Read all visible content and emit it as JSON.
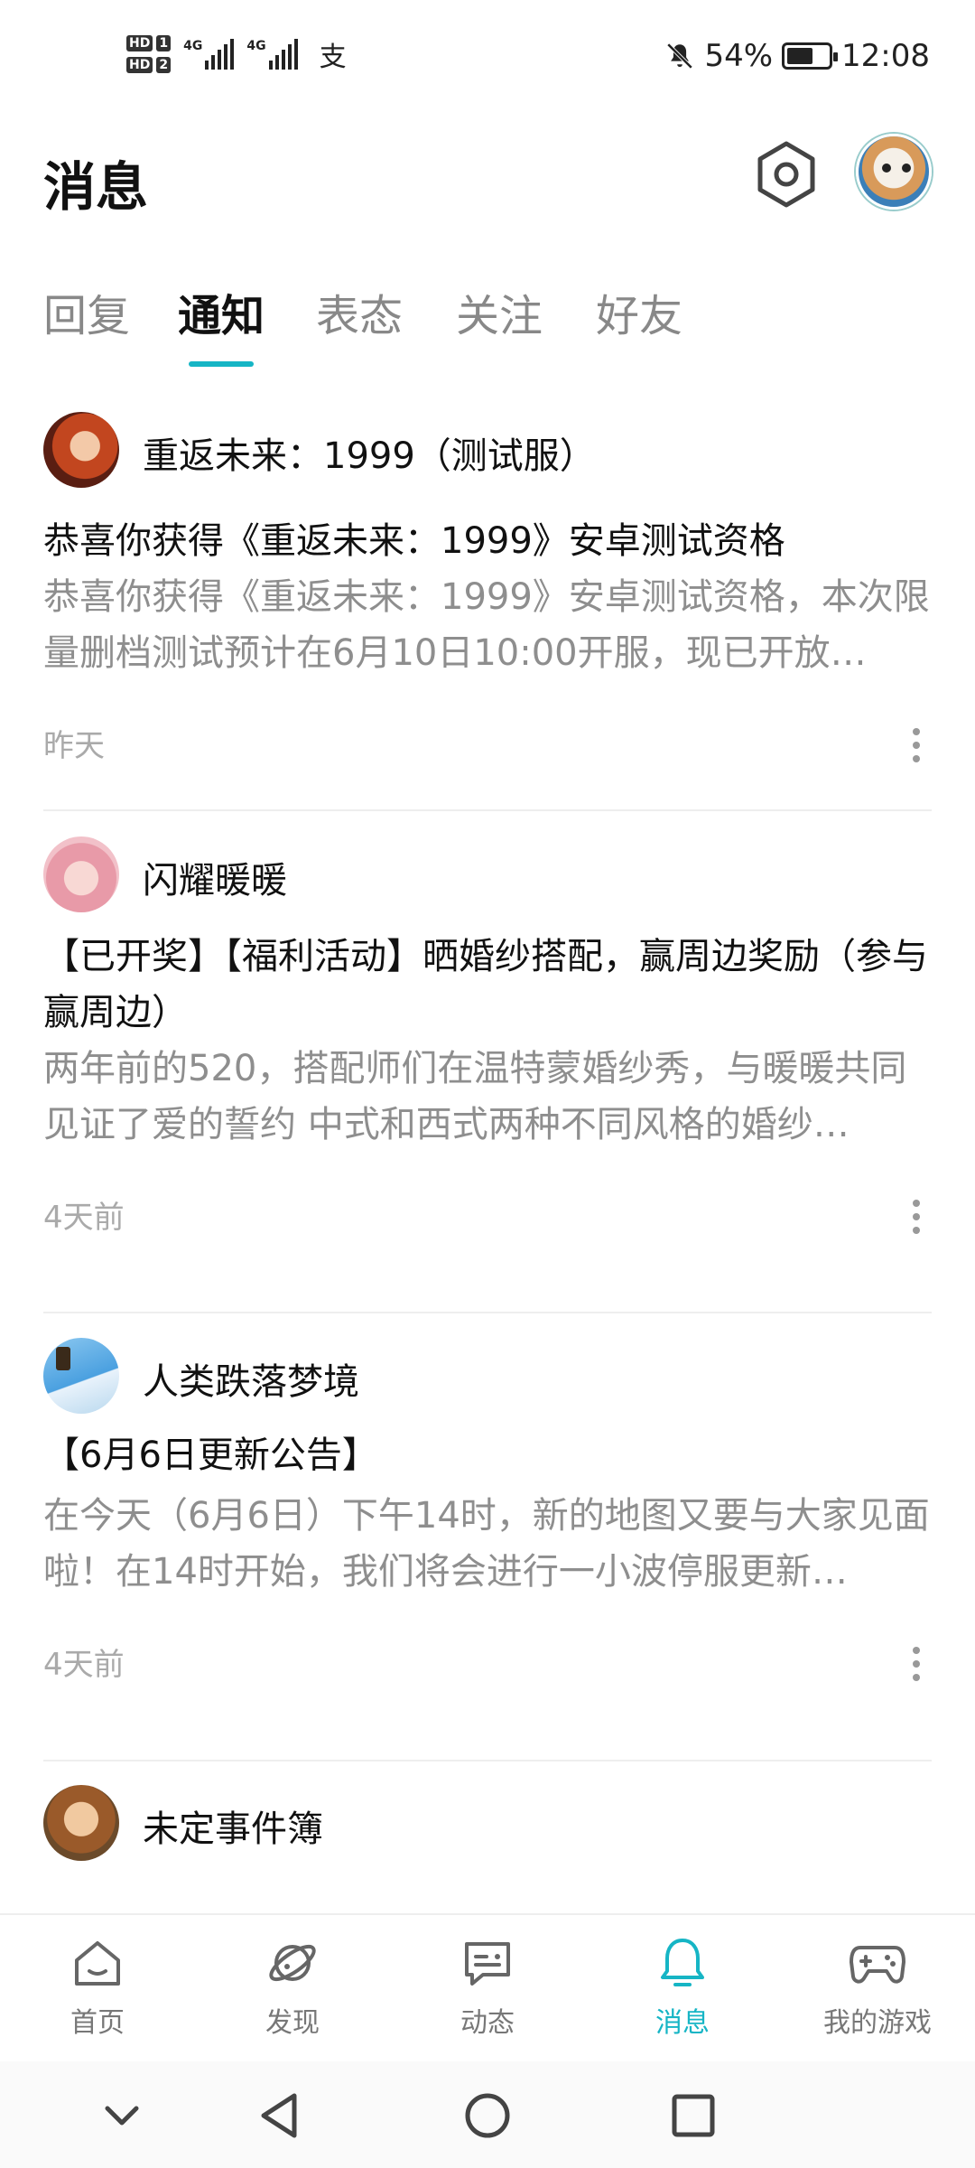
{
  "status_bar": {
    "left_labels": {
      "hd1": "HD",
      "sim1": "1",
      "hd2": "HD",
      "sim2": "2",
      "net1": "4G",
      "net2": "4G",
      "extra_icon": "支"
    },
    "battery": "54%",
    "time": "12:08",
    "icons": [
      "mute-bell-icon",
      "battery-icon"
    ]
  },
  "header": {
    "title": "消息",
    "settings_icon": "hexagon-settings-icon",
    "avatar_icon": "user-avatar"
  },
  "tabs": [
    {
      "label": "回复",
      "active": false
    },
    {
      "label": "通知",
      "active": true
    },
    {
      "label": "表态",
      "active": false
    },
    {
      "label": "关注",
      "active": false
    },
    {
      "label": "好友",
      "active": false
    }
  ],
  "accent_color": "#16b5c5",
  "notifications": [
    {
      "sender": "重返未来：1999（测试服）",
      "title": "恭喜你获得《重返未来：1999》安卓测试资格",
      "desc": "恭喜你获得《重返未来：1999》安卓测试资格，本次限量删档测试预计在6月10日10:00开服，现已开放…",
      "time": "昨天"
    },
    {
      "sender": "闪耀暖暖",
      "title": "【已开奖】【福利活动】晒婚纱搭配，赢周边奖励（参与赢周边）",
      "desc": "两年前的520，搭配师们在温特蒙婚纱秀，与暖暖共同见证了爱的誓约 中式和西式两种不同风格的婚纱…",
      "time": "4天前"
    },
    {
      "sender": "人类跌落梦境",
      "title": "【6月6日更新公告】",
      "desc": "在今天（6月6日）下午14时，新的地图又要与大家见面啦！在14时开始，我们将会进行一小波停服更新…",
      "time": "4天前"
    },
    {
      "sender": "未定事件簿"
    }
  ],
  "bottom_nav": [
    {
      "label": "首页",
      "icon": "home-icon",
      "active": false
    },
    {
      "label": "发现",
      "icon": "planet-icon",
      "active": false
    },
    {
      "label": "动态",
      "icon": "chat-bubble-icon",
      "active": false
    },
    {
      "label": "消息",
      "icon": "bell-icon",
      "active": true
    },
    {
      "label": "我的游戏",
      "icon": "gamepad-icon",
      "active": false
    }
  ],
  "system_nav": [
    "hide-chevron-icon",
    "back-triangle-icon",
    "home-circle-icon",
    "recents-square-icon"
  ]
}
